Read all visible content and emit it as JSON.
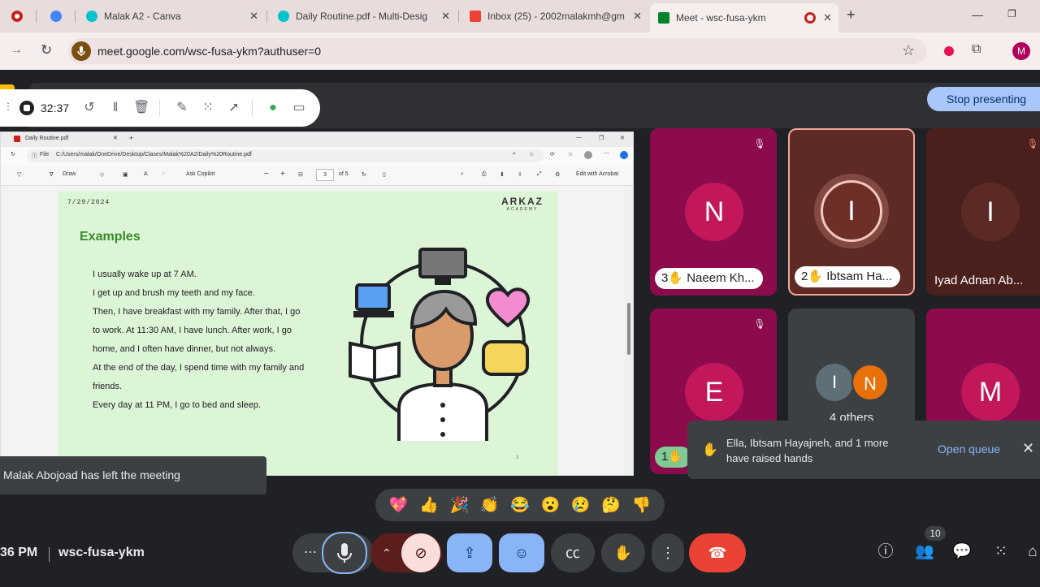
{
  "browser": {
    "tabs": [
      {
        "label": "",
        "color": "#c5221f"
      },
      {
        "label": "",
        "color": "#4285f4"
      },
      {
        "label": "Malak A2 - Canva",
        "color": "#00c4cc"
      },
      {
        "label": "Daily Routine.pdf - Multi-Desig",
        "color": "#00c4cc"
      },
      {
        "label": "Inbox (25) - 2002malakmh@gm",
        "color": "#ea4335"
      },
      {
        "label": "Meet - wsc-fusa-ykm",
        "color": "#00832d"
      }
    ],
    "new_tab_glyph": "+",
    "close_glyph": "✕",
    "url": "meet.google.com/wsc-fusa-ykm?authuser=0",
    "profile_initial": "M"
  },
  "presenter_bar": {
    "timer": "32:37",
    "stop_presenting_label": "Stop presenting"
  },
  "pdf": {
    "tab_title": "Daily Routine.pdf",
    "file_label": "File",
    "path": "C:/Users/malak/OneDrive/Desktop/Clases/Malak%20A2/Daily%20Routine.pdf",
    "draw_label": "Draw",
    "copilot_label": "Ask Copilot",
    "page_current": "3",
    "page_total": "of 5",
    "acrobat_label": "Edit with Acrobat"
  },
  "slide": {
    "date": "7/29/2024",
    "logo_main": "ARKAZ",
    "logo_sub": "ACADEMY",
    "heading": "Examples",
    "lines": [
      "I usually wake up at 7 AM.",
      "I get up and brush my teeth and my face.",
      "Then, I have breakfast with my family. After that, I go",
      "to work. At 11:30 AM, I have lunch. After work, I go",
      "home, and I often have dinner, but not always.",
      "At the end of the day, I spend time with my family and",
      "friends.",
      "Every day at 11 PM, I go to bed and sleep."
    ],
    "page_number": "3"
  },
  "participants": [
    {
      "initial": "N",
      "name": "Naeem Kh...",
      "hand": "3",
      "bg": "#8c0b4d",
      "avatar": "#c2185b"
    },
    {
      "initial": "I",
      "name": "Ibtsam Ha...",
      "hand": "2",
      "bg": "#5d2a25",
      "avatar": "#6d2f28"
    },
    {
      "initial": "I",
      "name": "Iyad Adnan Ab...",
      "hand": "",
      "bg": "#4a201d",
      "avatar": "#5b2a26"
    },
    {
      "initial": "E",
      "name": "",
      "hand": "1",
      "bg": "#8c0b4d",
      "avatar": "#c2185b"
    },
    {
      "initial": "",
      "name": "4 others",
      "hand": "",
      "bg": "#3c4043",
      "avatar": ""
    },
    {
      "initial": "M",
      "name": "",
      "hand": "",
      "bg": "#8c0b4d",
      "avatar": "#c2185b"
    }
  ],
  "others_avatars": [
    {
      "initial": "I",
      "color": "#5f6f78"
    },
    {
      "initial": "N",
      "color": "#e8710a"
    }
  ],
  "notifications": {
    "left_meeting": "Malak Abojoad has left the meeting",
    "raised_hands": "Ella, Ibtsam Hayajneh, and 1 more have raised hands",
    "open_queue": "Open queue"
  },
  "reactions": [
    "💖",
    "👍",
    "🎉",
    "👏",
    "😂",
    "😮",
    "😢",
    "🤔",
    "👎"
  ],
  "bottom": {
    "time": "36 PM",
    "meeting_code": "wsc-fusa-ykm",
    "people_count": "10"
  }
}
